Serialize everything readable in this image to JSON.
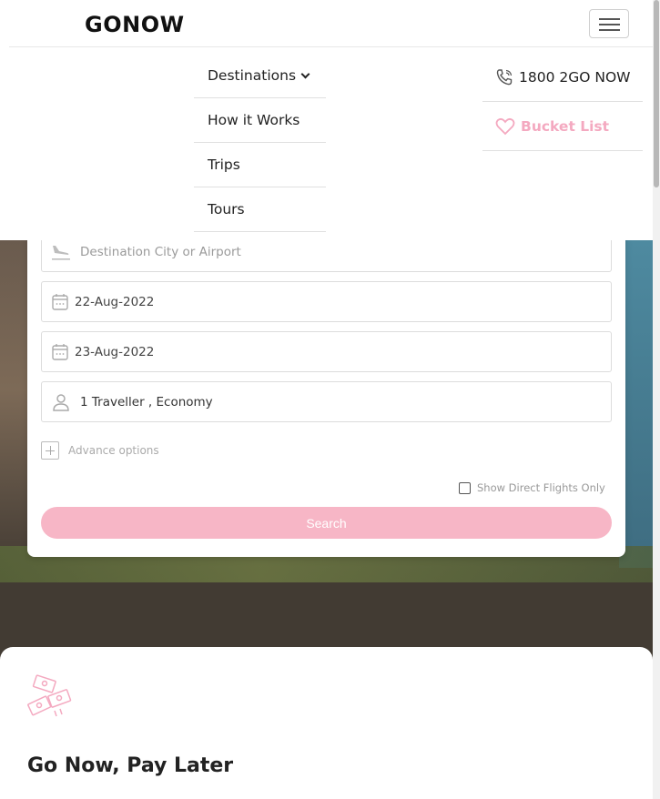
{
  "header": {
    "logo": "GONOW"
  },
  "nav": {
    "items": [
      {
        "label": "Destinations"
      },
      {
        "label": "How it Works"
      },
      {
        "label": "Trips"
      },
      {
        "label": "Tours"
      }
    ],
    "phone": "1800 2GO NOW",
    "bucket_list": "Bucket List"
  },
  "search": {
    "destination_placeholder": "Destination City or Airport",
    "depart_date": "22-Aug-2022",
    "return_date": "23-Aug-2022",
    "travellers": "1 Traveller , Economy",
    "advance_options": "Advance options",
    "direct_flights": "Show Direct Flights Only",
    "button": "Search"
  },
  "info": {
    "title": "Go Now, Pay Later"
  },
  "colors": {
    "accent": "#f7b6c6",
    "bucket": "#f4a9c0"
  }
}
